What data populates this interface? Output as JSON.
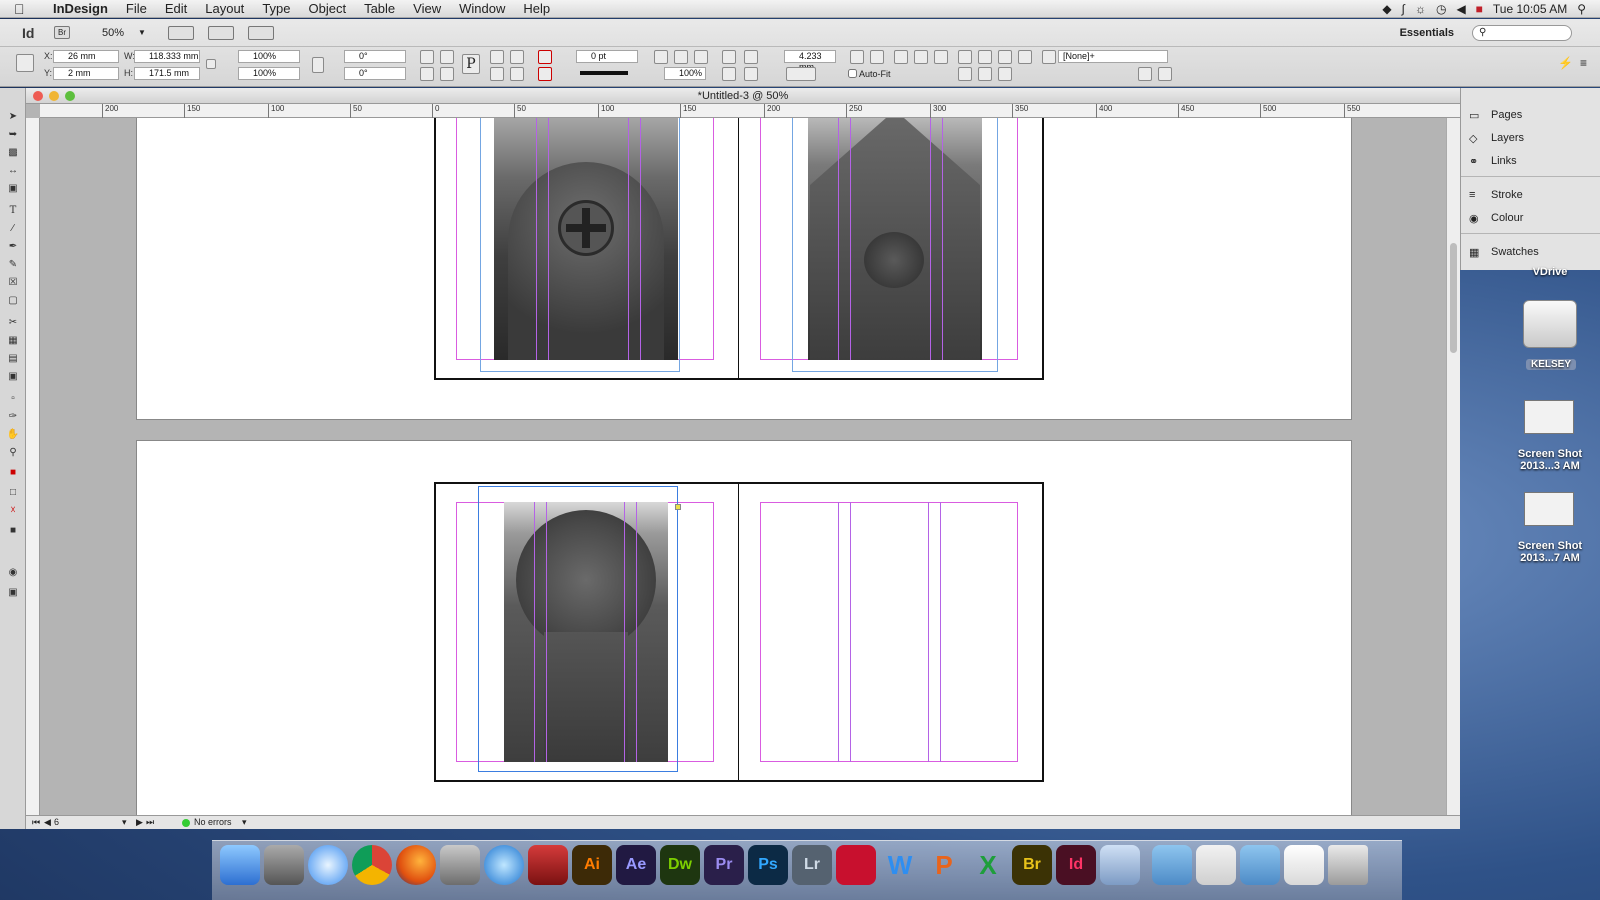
{
  "menubar": {
    "app": "InDesign",
    "menus": [
      "File",
      "Edit",
      "Layout",
      "Type",
      "Object",
      "Table",
      "View",
      "Window",
      "Help"
    ],
    "clock": "Tue 10:05 AM"
  },
  "appbar": {
    "logo": "Id",
    "bridge": "Br",
    "zoom": "50%",
    "workspace": "Essentials"
  },
  "control": {
    "x": "26 mm",
    "y": "2 mm",
    "w": "118.333 mm",
    "h": "171.5 mm",
    "scale_x": "100%",
    "scale_y": "100%",
    "angle": "0°",
    "shear": "0°",
    "stroke": "0 pt",
    "opacity": "100%",
    "gutter": "4.233 mm",
    "style": "[None]+",
    "autofit": "Auto-Fit"
  },
  "document": {
    "title": "*Untitled-3 @ 50%",
    "ruler_labels": [
      "200",
      "150",
      "100",
      "50",
      "0",
      "50",
      "100",
      "150",
      "200",
      "250",
      "300",
      "350",
      "400",
      "450",
      "500",
      "550"
    ],
    "page_number": "6",
    "status": "No errors"
  },
  "panels": {
    "pages": "Pages",
    "layers": "Layers",
    "links": "Links",
    "stroke": "Stroke",
    "colour": "Colour",
    "swatches": "Swatches"
  },
  "desktop": {
    "vdrive": "VDrive",
    "kelsey": "KELSEY",
    "screenshot1": "Screen Shot 2013...3 AM",
    "screenshot2": "Screen Shot 2013...7 AM"
  },
  "dock": {
    "apps": [
      "Finder",
      "Launchpad",
      "Safari",
      "Chrome",
      "Firefox",
      "FaceTime",
      "iTunes",
      "Photo Booth",
      "Ai",
      "Ae",
      "Dw",
      "Pr",
      "Ps",
      "Lr",
      "FileZilla",
      "W",
      "P",
      "X",
      "Br",
      "Id",
      "Preview",
      "Downloads",
      "Documents",
      "Applications",
      "Mail",
      "Trash"
    ]
  },
  "colors": {
    "margin": "#d95ce0",
    "column": "#b463e6",
    "bleed": "#74a6e2",
    "illustrator": "#ff7c00",
    "aftereffects": "#9999ff",
    "dreamweaver": "#7ccf00",
    "premiere": "#9b8cf0",
    "photoshop": "#31a8ff",
    "indesign": "#ff3366"
  }
}
